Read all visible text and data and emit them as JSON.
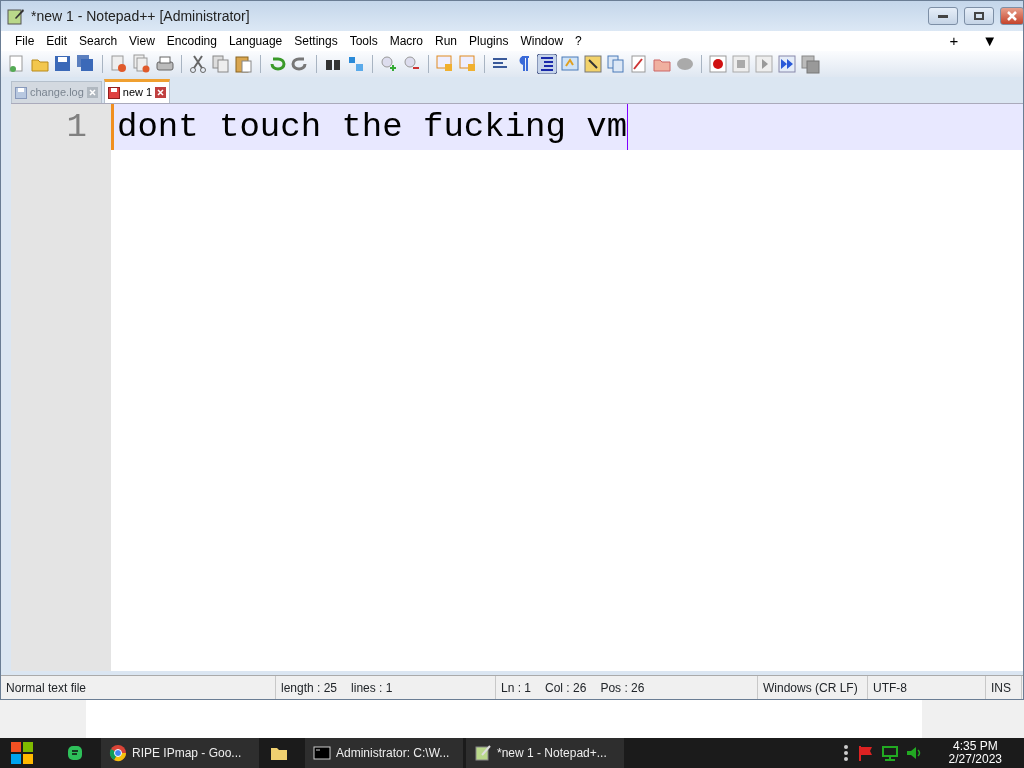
{
  "window": {
    "title": "*new 1 - Notepad++ [Administrator]"
  },
  "menu": [
    "File",
    "Edit",
    "Search",
    "View",
    "Encoding",
    "Language",
    "Settings",
    "Tools",
    "Macro",
    "Run",
    "Plugins",
    "Window",
    "?"
  ],
  "menu_right": [
    "+",
    "▼"
  ],
  "tabs": [
    {
      "label": "change.log",
      "selected": false,
      "modified": false
    },
    {
      "label": "new 1",
      "selected": true,
      "modified": true
    }
  ],
  "editor": {
    "lines": [
      {
        "number": "1",
        "text": "dont touch the fucking vm",
        "current": true
      }
    ]
  },
  "status_bar": {
    "file_type": "Normal text file",
    "length": "length : 25",
    "lines": "lines : 1",
    "ln": "Ln : 1",
    "col": "Col : 26",
    "pos": "Pos : 26",
    "eol": "Windows (CR LF)",
    "encoding": "UTF-8",
    "mode": "INS"
  },
  "taskbar": {
    "items": [
      {
        "kind": "app"
      },
      {
        "kind": "browser",
        "label": "RIPE IPmap - Goo..."
      },
      {
        "kind": "folder"
      },
      {
        "kind": "console",
        "label": "Administrator: C:\\W..."
      },
      {
        "kind": "notepad",
        "label": "*new 1 - Notepad+..."
      }
    ],
    "time": "4:35 PM",
    "date": "2/27/2023"
  }
}
